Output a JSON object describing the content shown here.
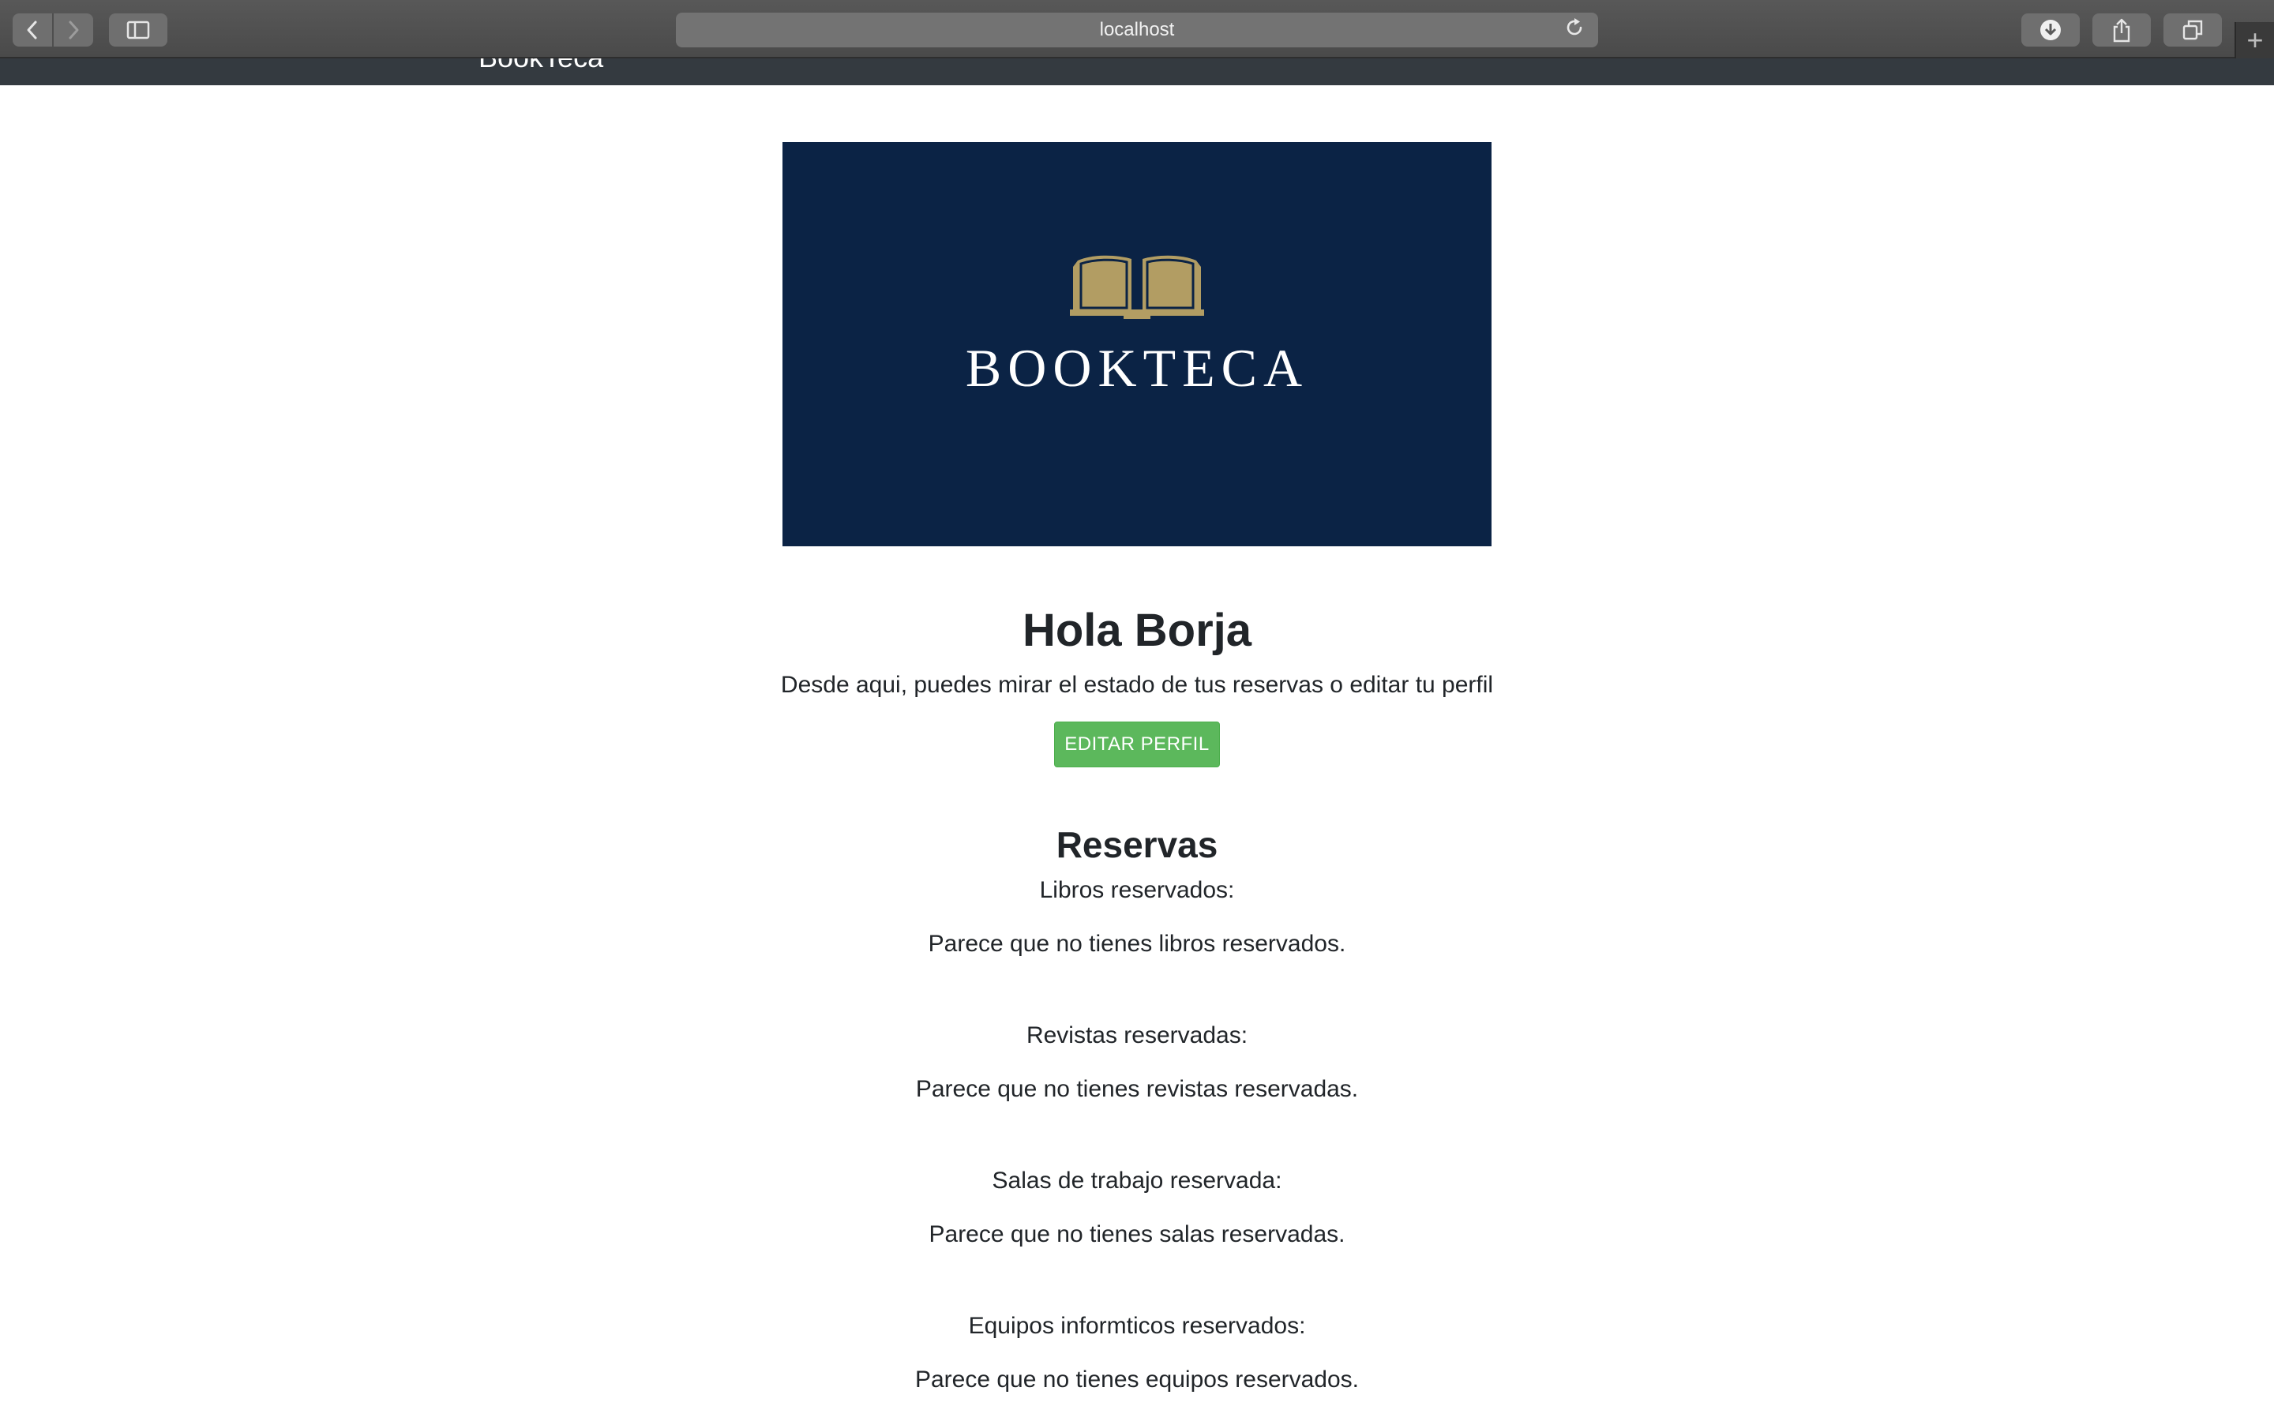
{
  "browser": {
    "url": "localhost",
    "icons": {
      "back": "chevron-left-icon",
      "forward": "chevron-right-icon",
      "sidebar": "sidebar-icon",
      "reload": "reload-icon",
      "download": "download-icon",
      "share": "share-icon",
      "tabs": "tabs-icon",
      "new_tab": "plus-icon"
    }
  },
  "navbar": {
    "brand": "BookTeca"
  },
  "banner": {
    "logo_text": "BOOKTECA",
    "background_color": "#0b2345",
    "accent_color": "#b29d63"
  },
  "profile": {
    "greeting": "Hola Borja",
    "intro": "Desde aqui, puedes mirar el estado de tus reservas o editar tu perfil",
    "edit_button": "EDITAR PERFIL",
    "button_color": "#5cb85c"
  },
  "reservations": {
    "title": "Reservas",
    "sections": [
      {
        "label": "Libros reservados:",
        "empty": "Parece que no tienes libros reservados."
      },
      {
        "label": "Revistas reservadas:",
        "empty": "Parece que no tienes revistas reservadas."
      },
      {
        "label": "Salas de trabajo reservada:",
        "empty": "Parece que no tienes salas reservadas."
      },
      {
        "label": "Equipos informticos reservados:",
        "empty": "Parece que no tienes equipos reservados."
      }
    ]
  }
}
